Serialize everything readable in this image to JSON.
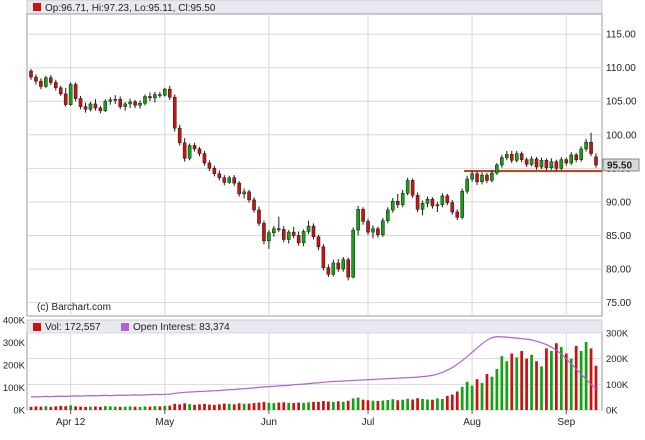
{
  "header": {
    "ohlc_text": "Op:96.71, Hi:97.23, Lo:95.11, Cl:95.50"
  },
  "watermark": "(c) Barchart.com",
  "colors": {
    "up": "#11a311",
    "down": "#cc1111",
    "grid": "#d8d8d8",
    "support_line": "#b44a28",
    "open_interest": "#b15fd6",
    "header_bg": "#e9e9f1",
    "last_price_badge": "#d9d9d9"
  },
  "chart_data": [
    {
      "type": "candlestick",
      "title": "",
      "ylim": [
        73,
        118
      ],
      "y_ticks": [
        "75.00",
        "80.00",
        "85.00",
        "90.00",
        "95.00",
        "100.00",
        "105.00",
        "110.00",
        "115.00"
      ],
      "y_tick_values": [
        75,
        80,
        85,
        90,
        95,
        100,
        105,
        110,
        115
      ],
      "x_labels": [
        "Apr 12",
        "May",
        "Jun",
        "Jul",
        "Aug",
        "Sep"
      ],
      "last_price_label": "95.50",
      "last_price": 95.5,
      "support_level": 94.6,
      "grid": true,
      "ohlc": [
        [
          109.5,
          109.8,
          108.2,
          108.6
        ],
        [
          108.6,
          109.0,
          107.5,
          108.0
        ],
        [
          108.0,
          108.4,
          106.8,
          107.2
        ],
        [
          107.2,
          108.8,
          107.0,
          108.5
        ],
        [
          108.5,
          108.9,
          107.4,
          107.8
        ],
        [
          107.8,
          108.2,
          106.6,
          107.0
        ],
        [
          107.0,
          107.3,
          105.8,
          106.1
        ],
        [
          106.1,
          107.0,
          104.2,
          104.5
        ],
        [
          104.5,
          107.8,
          104.3,
          107.5
        ],
        [
          107.5,
          107.8,
          105.0,
          105.4
        ],
        [
          105.4,
          105.8,
          103.8,
          104.2
        ],
        [
          104.2,
          104.8,
          103.3,
          103.8
        ],
        [
          103.8,
          104.9,
          103.5,
          104.6
        ],
        [
          104.6,
          105.3,
          103.6,
          104.0
        ],
        [
          104.0,
          104.3,
          103.2,
          103.6
        ],
        [
          103.6,
          105.3,
          103.4,
          105.0
        ],
        [
          105.0,
          105.6,
          104.5,
          105.2
        ],
        [
          105.2,
          105.9,
          104.6,
          105.3
        ],
        [
          105.3,
          105.7,
          103.8,
          104.2
        ],
        [
          104.2,
          104.9,
          103.6,
          104.6
        ],
        [
          104.6,
          105.4,
          104.0,
          104.9
        ],
        [
          104.9,
          105.2,
          104.0,
          104.4
        ],
        [
          104.4,
          105.1,
          103.9,
          104.7
        ],
        [
          104.7,
          106.0,
          104.4,
          105.7
        ],
        [
          105.7,
          106.3,
          105.0,
          105.5
        ],
        [
          105.5,
          106.4,
          104.8,
          106.0
        ],
        [
          106.0,
          106.4,
          105.5,
          105.9
        ],
        [
          105.9,
          107.0,
          105.7,
          106.8
        ],
        [
          106.8,
          107.3,
          105.2,
          105.6
        ],
        [
          105.6,
          106.0,
          100.5,
          101.0
        ],
        [
          101.0,
          101.5,
          98.4,
          98.8
        ],
        [
          98.8,
          99.5,
          96.0,
          96.5
        ],
        [
          96.5,
          98.7,
          96.2,
          98.4
        ],
        [
          98.4,
          98.8,
          97.5,
          97.9
        ],
        [
          97.9,
          98.2,
          96.8,
          97.2
        ],
        [
          97.2,
          97.6,
          95.4,
          95.8
        ],
        [
          95.8,
          96.2,
          94.6,
          95.0
        ],
        [
          95.0,
          95.4,
          93.8,
          94.2
        ],
        [
          94.2,
          94.7,
          93.2,
          93.6
        ],
        [
          93.6,
          94.0,
          92.5,
          92.9
        ],
        [
          92.9,
          93.9,
          92.7,
          93.6
        ],
        [
          93.6,
          94.0,
          92.4,
          92.8
        ],
        [
          92.8,
          93.1,
          90.8,
          91.2
        ],
        [
          91.2,
          92.0,
          90.5,
          91.5
        ],
        [
          91.5,
          91.8,
          89.9,
          90.3
        ],
        [
          90.3,
          90.7,
          88.4,
          88.8
        ],
        [
          88.8,
          89.3,
          86.4,
          86.8
        ],
        [
          86.8,
          87.2,
          83.7,
          84.2
        ],
        [
          84.2,
          85.8,
          83.0,
          85.4
        ],
        [
          85.4,
          86.4,
          84.8,
          86.0
        ],
        [
          86.0,
          87.8,
          85.5,
          85.9
        ],
        [
          85.9,
          86.4,
          84.0,
          84.4
        ],
        [
          84.4,
          85.8,
          83.8,
          85.5
        ],
        [
          85.5,
          86.3,
          84.6,
          85.0
        ],
        [
          85.0,
          85.6,
          83.5,
          83.9
        ],
        [
          83.9,
          85.9,
          83.4,
          85.6
        ],
        [
          85.6,
          87.2,
          85.2,
          86.4
        ],
        [
          86.4,
          86.8,
          84.4,
          84.8
        ],
        [
          84.8,
          85.1,
          82.8,
          83.3
        ],
        [
          83.3,
          83.7,
          79.8,
          80.2
        ],
        [
          80.2,
          80.7,
          78.8,
          79.2
        ],
        [
          79.2,
          81.4,
          78.9,
          80.9
        ],
        [
          80.9,
          81.5,
          79.6,
          80.0
        ],
        [
          80.0,
          81.8,
          79.6,
          81.4
        ],
        [
          81.4,
          81.7,
          78.3,
          78.8
        ],
        [
          78.8,
          86.2,
          78.6,
          85.8
        ],
        [
          85.8,
          89.4,
          85.0,
          88.9
        ],
        [
          88.9,
          89.2,
          86.6,
          87.1
        ],
        [
          87.1,
          87.5,
          85.1,
          85.5
        ],
        [
          85.5,
          86.5,
          84.6,
          86.0
        ],
        [
          86.0,
          86.3,
          84.7,
          85.1
        ],
        [
          85.1,
          87.6,
          84.8,
          87.2
        ],
        [
          87.2,
          89.2,
          86.8,
          88.8
        ],
        [
          88.8,
          90.6,
          88.4,
          90.1
        ],
        [
          90.1,
          91.2,
          89.1,
          89.6
        ],
        [
          89.6,
          91.8,
          89.2,
          91.3
        ],
        [
          91.3,
          93.6,
          91.0,
          93.2
        ],
        [
          93.2,
          93.5,
          90.6,
          91.0
        ],
        [
          91.0,
          91.4,
          88.5,
          88.9
        ],
        [
          88.9,
          90.2,
          88.0,
          89.8
        ],
        [
          89.8,
          90.8,
          89.2,
          90.4
        ],
        [
          90.4,
          90.7,
          89.0,
          89.4
        ],
        [
          89.4,
          90.0,
          88.5,
          89.6
        ],
        [
          89.6,
          91.3,
          89.2,
          90.9
        ],
        [
          90.9,
          91.2,
          89.5,
          89.9
        ],
        [
          89.9,
          90.3,
          88.1,
          88.5
        ],
        [
          88.5,
          88.9,
          87.3,
          87.7
        ],
        [
          87.7,
          92.0,
          87.4,
          91.6
        ],
        [
          91.6,
          93.9,
          91.2,
          93.4
        ],
        [
          93.4,
          94.6,
          93.0,
          94.2
        ],
        [
          94.2,
          94.5,
          92.5,
          93.0
        ],
        [
          93.0,
          94.4,
          92.6,
          94.0
        ],
        [
          94.0,
          94.3,
          92.8,
          93.2
        ],
        [
          93.2,
          94.7,
          92.9,
          94.3
        ],
        [
          94.3,
          95.8,
          94.0,
          95.5
        ],
        [
          95.5,
          97.0,
          95.1,
          96.6
        ],
        [
          96.6,
          97.6,
          96.2,
          97.1
        ],
        [
          97.1,
          97.6,
          95.8,
          96.2
        ],
        [
          96.2,
          97.6,
          95.9,
          97.2
        ],
        [
          97.2,
          97.5,
          95.9,
          96.3
        ],
        [
          96.3,
          96.6,
          95.2,
          95.6
        ],
        [
          95.6,
          96.8,
          95.3,
          96.4
        ],
        [
          96.4,
          96.7,
          94.8,
          95.2
        ],
        [
          95.2,
          96.6,
          94.9,
          96.2
        ],
        [
          96.2,
          96.5,
          94.7,
          95.1
        ],
        [
          95.1,
          96.5,
          94.8,
          96.0
        ],
        [
          96.0,
          96.3,
          94.6,
          95.0
        ],
        [
          95.0,
          96.7,
          94.7,
          96.3
        ],
        [
          96.3,
          96.6,
          95.4,
          95.8
        ],
        [
          95.8,
          97.4,
          95.5,
          97.0
        ],
        [
          97.0,
          97.3,
          95.9,
          96.3
        ],
        [
          96.3,
          98.3,
          96.0,
          97.9
        ],
        [
          97.9,
          99.4,
          97.5,
          98.9
        ],
        [
          98.9,
          100.3,
          96.8,
          97.2
        ],
        [
          96.71,
          97.23,
          95.11,
          95.5
        ]
      ]
    },
    {
      "type": "bar+line",
      "ylim": [
        0,
        300000
      ],
      "y_ticks_left": [
        "0K",
        "100K",
        "200K",
        "300K",
        "400K"
      ],
      "y_tick_values_left": [
        0,
        100000,
        200000,
        300000,
        400000
      ],
      "y_ticks_right": [
        "0K",
        "100K",
        "200K",
        "300K"
      ],
      "y_tick_values_right": [
        0,
        100000,
        200000,
        300000
      ],
      "legend": [
        {
          "label": "Vol: 172,557",
          "color": "#cc1111"
        },
        {
          "label": "Open Interest: 83,374",
          "color": "#b15fd6"
        }
      ],
      "volume": [
        12000,
        14000,
        13000,
        15000,
        12000,
        14000,
        16000,
        15000,
        18000,
        14000,
        13000,
        12000,
        13000,
        14000,
        12000,
        15000,
        14000,
        13000,
        12000,
        13000,
        14000,
        13000,
        12000,
        14000,
        13000,
        15000,
        14000,
        16000,
        17000,
        24000,
        22000,
        26000,
        23000,
        20000,
        22000,
        24000,
        21000,
        20000,
        22000,
        25000,
        24000,
        22000,
        26000,
        24000,
        25000,
        27000,
        29000,
        31000,
        28000,
        27000,
        29000,
        30000,
        28000,
        27000,
        29000,
        28000,
        30000,
        31000,
        32000,
        35000,
        33000,
        31000,
        34000,
        32000,
        36000,
        45000,
        48000,
        40000,
        38000,
        36000,
        35000,
        37000,
        39000,
        42000,
        38000,
        40000,
        44000,
        41000,
        46000,
        43000,
        41000,
        40000,
        45000,
        43000,
        55000,
        60000,
        72000,
        90000,
        110000,
        95000,
        120000,
        105000,
        140000,
        130000,
        160000,
        210000,
        190000,
        220000,
        205000,
        230000,
        200000,
        215000,
        190000,
        170000,
        240000,
        230000,
        260000,
        245000,
        220000,
        200000,
        250000,
        230000,
        265000,
        240000,
        172557
      ],
      "open_interest": [
        52000,
        51000,
        52000,
        53000,
        52000,
        53000,
        54000,
        53000,
        54000,
        55000,
        54000,
        55000,
        56000,
        55000,
        56000,
        57000,
        56000,
        57000,
        58000,
        57000,
        58000,
        59000,
        58000,
        59000,
        60000,
        61000,
        60000,
        61000,
        62000,
        65000,
        67000,
        69000,
        70000,
        71000,
        72000,
        73000,
        74000,
        75000,
        76000,
        78000,
        79000,
        80000,
        82000,
        83000,
        84000,
        86000,
        88000,
        90000,
        91000,
        92000,
        94000,
        95000,
        96000,
        98000,
        100000,
        101000,
        103000,
        105000,
        106000,
        108000,
        110000,
        111000,
        112000,
        113000,
        114000,
        115000,
        116000,
        117000,
        118000,
        119000,
        120000,
        121000,
        122000,
        123000,
        124000,
        125000,
        126000,
        127000,
        128000,
        130000,
        132000,
        135000,
        140000,
        146000,
        155000,
        165000,
        178000,
        192000,
        208000,
        225000,
        242000,
        258000,
        272000,
        282000,
        286000,
        285000,
        284000,
        282000,
        280000,
        278000,
        276000,
        273000,
        268000,
        262000,
        255000,
        245000,
        233000,
        218000,
        200000,
        180000,
        160000,
        140000,
        120000,
        100000,
        83374
      ]
    }
  ]
}
